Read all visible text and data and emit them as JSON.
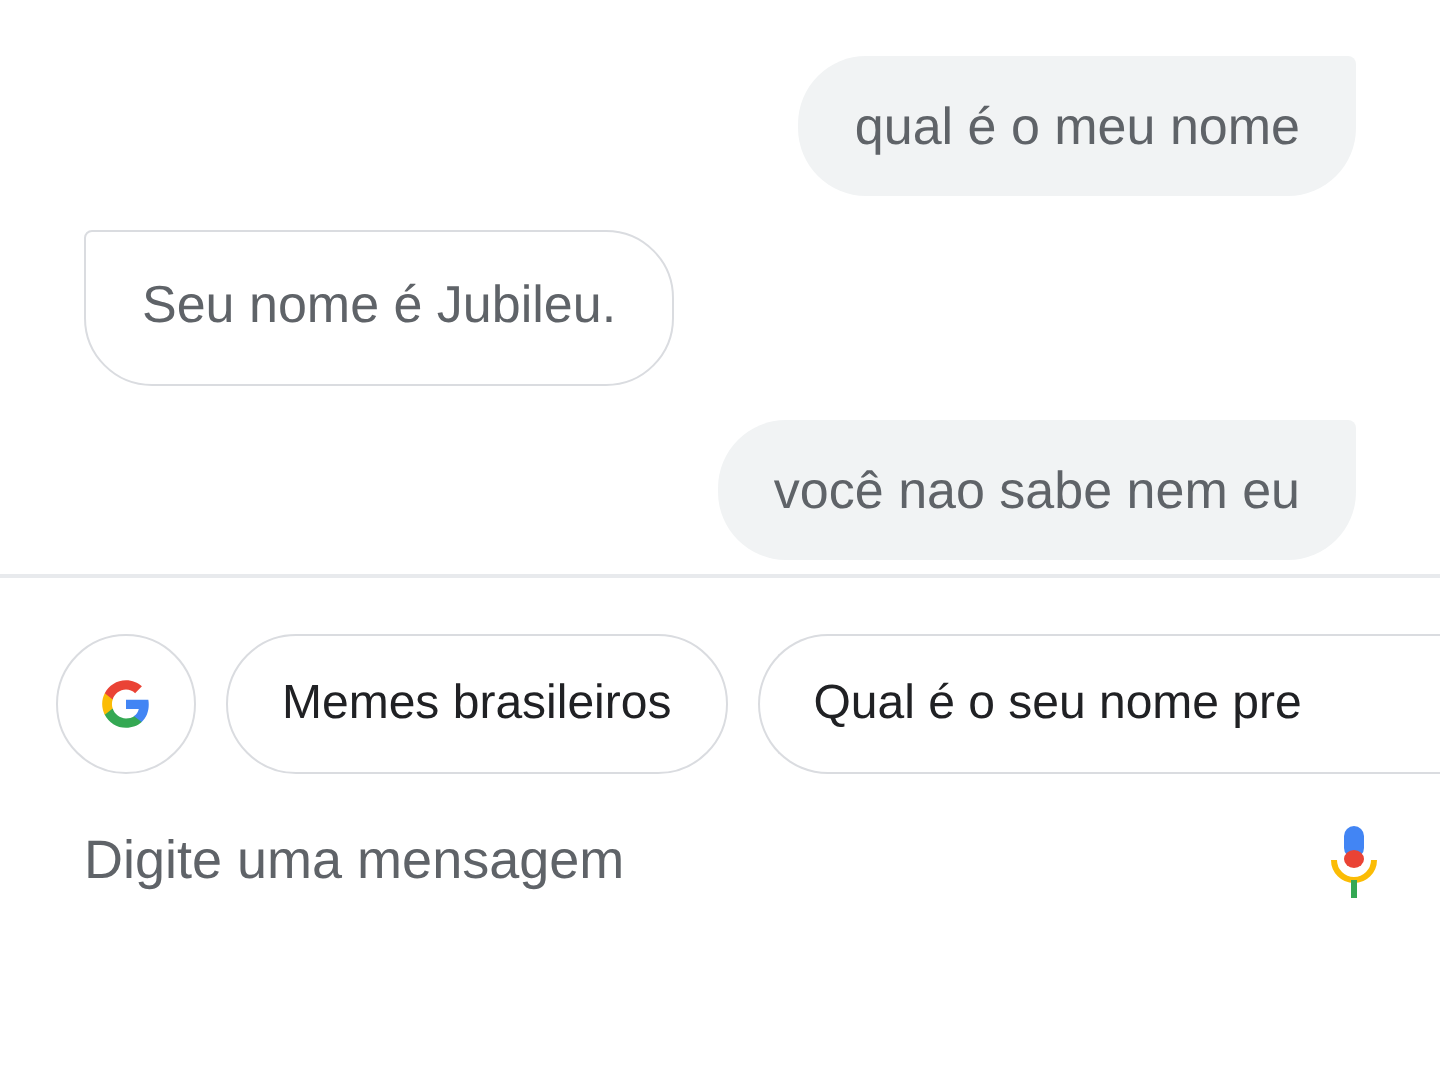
{
  "messages": [
    {
      "kind": "user",
      "text": "qual é o meu nome"
    },
    {
      "kind": "assistant",
      "text": "Seu nome é Jubileu."
    },
    {
      "kind": "user",
      "text": "você nao sabe nem eu"
    }
  ],
  "suggestions": [
    {
      "label": "Memes brasileiros"
    },
    {
      "label": "Qual é o seu nome pre"
    }
  ],
  "composer": {
    "placeholder": "Digite uma mensagem"
  }
}
